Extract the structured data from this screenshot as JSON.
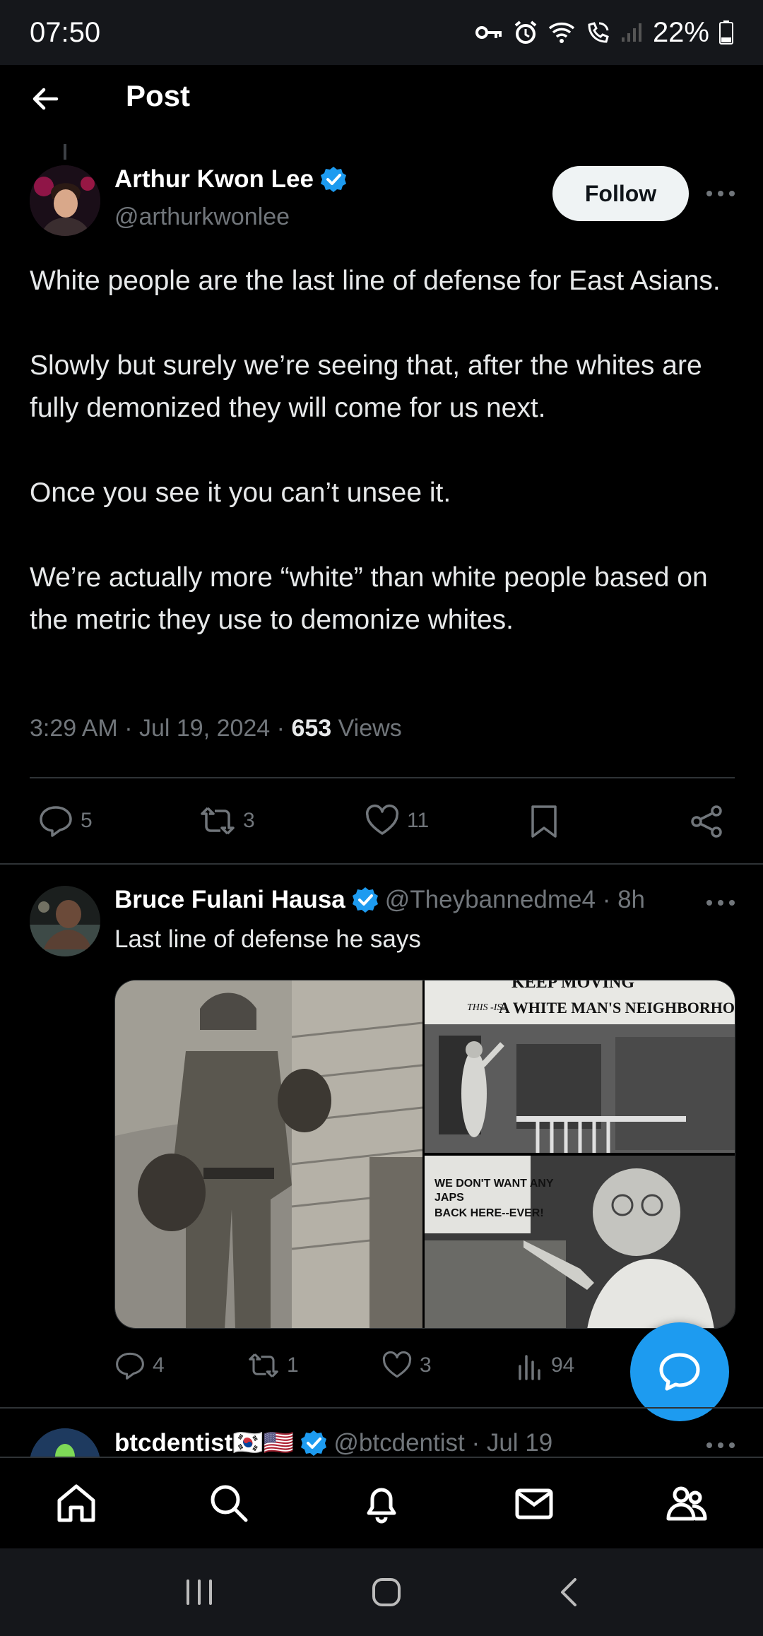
{
  "status_bar": {
    "time": "07:50",
    "battery": "22%",
    "icons": [
      "vpn-key-icon",
      "alarm-icon",
      "wifi-icon",
      "wifi-calling-icon",
      "signal-icon",
      "battery-icon"
    ]
  },
  "header": {
    "title": "Post"
  },
  "post": {
    "author_name": "Arthur Kwon Lee",
    "handle": "@arthurkwonlee",
    "follow_label": "Follow",
    "paragraphs": [
      "White people are the last line of defense for East Asians.",
      "Slowly but surely we’re seeing that, after the whites are fully demonized they will come for us next.",
      "Once you see it you can’t unsee it.",
      "We’re actually more “white” than white people based on the metric they use to demonize whites."
    ],
    "timestamp": "3:29 AM · Jul 19, 2024 · ",
    "views_count": "653",
    "views_label": " Views",
    "replies": "5",
    "reposts": "3",
    "likes": "11"
  },
  "reply": {
    "author_name": "Bruce Fulani Hausa",
    "handle_time": "@Theybannedme4 · 8h",
    "text": "Last line of defense he says",
    "image_texts": {
      "sign_top": "THIS IS A WHITE MAN'S NEIGHBORHOOD.",
      "sign_top_prefix": "THIS -IS-",
      "sign_top_main": "A WHITE MAN'S NEIGHBORHOOD.",
      "sign_partial": "KEEP MOVING",
      "sign_bottom_lines": [
        "WE DON'T WANT ANY",
        "JAPS",
        "BACK HERE--EVER!"
      ]
    },
    "replies": "4",
    "reposts": "1",
    "likes": "3",
    "views": "94"
  },
  "next_reply": {
    "author_name": "btcdentist🇰🇷🇺🇸",
    "handle_time": "@btcdentist · Jul 19"
  },
  "colors": {
    "accent": "#1d9bf0",
    "background": "#000000",
    "muted_text": "#71767b",
    "divider": "#2f3336"
  }
}
